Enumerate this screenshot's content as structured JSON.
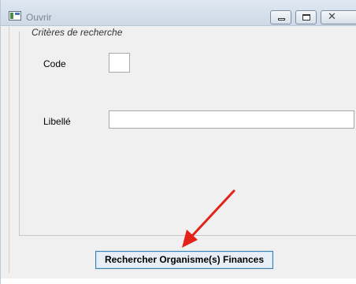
{
  "window": {
    "title": "Ouvrir",
    "controls": {
      "minimize_icon": "minimize-icon",
      "maximize_icon": "maximize-icon",
      "close_icon": "close-icon"
    }
  },
  "form": {
    "group_label": "Critères de recherche",
    "fields": [
      {
        "label": "Code",
        "value": ""
      },
      {
        "label": "Libellé",
        "value": ""
      }
    ],
    "search_button_label": "Rechercher Organisme(s) Finances"
  },
  "annotation": {
    "arrow_color": "#e2231a"
  }
}
